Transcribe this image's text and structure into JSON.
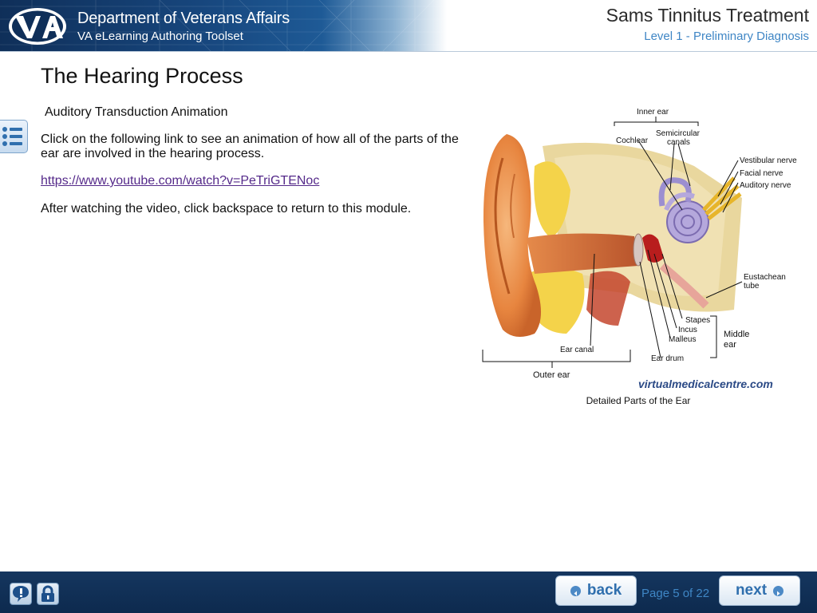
{
  "header": {
    "department": "Department of Veterans Affairs",
    "toolset": "VA eLearning Authoring Toolset",
    "course_title": "Sams Tinnitus Treatment",
    "level": "Level 1 - Preliminary Diagnosis",
    "logo_text": "VA"
  },
  "content": {
    "page_title": "The Hearing Process",
    "subheading": "Auditory Transduction Animation",
    "instructions": "Click on the following link to see an animation of how all of the parts of the ear are involved in the hearing process.",
    "video_link": "https://www.youtube.com/watch?v=PeTriGTENoc",
    "after_note": "After watching the video, click backspace to return to this module."
  },
  "figure": {
    "caption": "Detailed Parts of the Ear",
    "labels": {
      "inner_ear": "Inner ear",
      "cochlear": "Cochlear",
      "semicircular": "Semicircular",
      "canals": "canals",
      "vestibular_nerve": "Vestibular nerve",
      "facial_nerve": "Facial  nerve",
      "auditory_nerve": "Auditory nerve",
      "eustachean": "Eustachean",
      "tube": "tube",
      "stapes": "Stapes",
      "incus": "Incus",
      "malleus": "Malleus",
      "middle": "Middle",
      "ear": "ear",
      "ear_drum": "Ear drum",
      "ear_canal": "Ear canal",
      "outer_ear": "Outer ear",
      "watermark": "virtualmedicalcentre.com"
    }
  },
  "footer": {
    "back_label": "back",
    "next_label": "next",
    "page_indicator": "Page 5 of 22",
    "help_icon": "help-icon",
    "lock_icon": "lock-icon"
  },
  "colors": {
    "header_blue": "#17467d",
    "link_purple": "#552a8a",
    "accent_blue": "#3f86c5",
    "footer_navy": "#0d2a4e"
  }
}
